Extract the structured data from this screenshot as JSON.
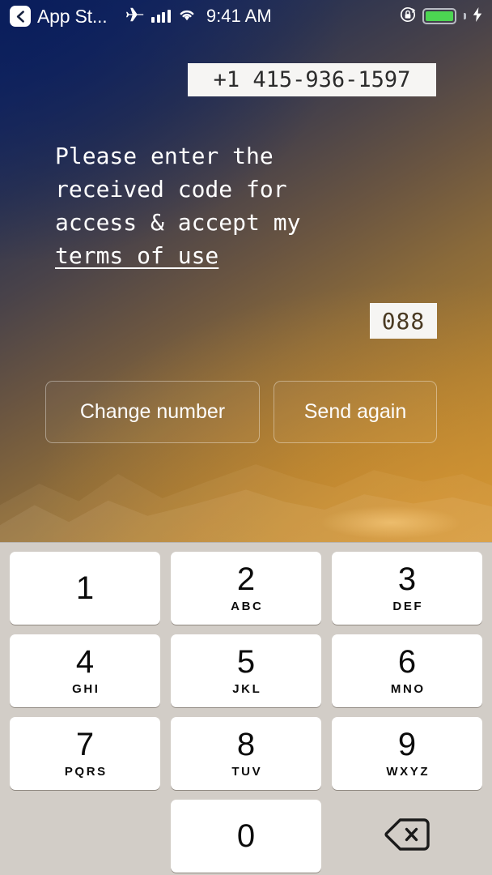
{
  "status_bar": {
    "back_icon": "chevron-left-icon",
    "back_app_label": "App St...",
    "airplane_icon": "airplane-icon",
    "signal_icon": "cellular-bars-icon",
    "wifi_icon": "wifi-icon",
    "time": "9:41 AM",
    "rotation_lock_icon": "rotation-lock-icon",
    "battery_icon": "battery-full-icon",
    "charging_icon": "lightning-bolt-icon",
    "battery_color": "#4cd552"
  },
  "phone_field": {
    "value": "+1 415-936-1597",
    "placeholder": "Phone number"
  },
  "instruction": {
    "line1": "Please enter the",
    "line2": "received code for",
    "line3": "access & accept my",
    "terms_link": "terms of use"
  },
  "code_field": {
    "value": "088",
    "placeholder": "Code"
  },
  "actions": {
    "change_number_label": "Change number",
    "send_again_label": "Send again"
  },
  "keypad": {
    "keys": [
      {
        "digit": "1",
        "letters": ""
      },
      {
        "digit": "2",
        "letters": "ABC"
      },
      {
        "digit": "3",
        "letters": "DEF"
      },
      {
        "digit": "4",
        "letters": "GHI"
      },
      {
        "digit": "5",
        "letters": "JKL"
      },
      {
        "digit": "6",
        "letters": "MNO"
      },
      {
        "digit": "7",
        "letters": "PQRS"
      },
      {
        "digit": "8",
        "letters": "TUV"
      },
      {
        "digit": "9",
        "letters": "WXYZ"
      },
      {
        "digit": "0",
        "letters": ""
      }
    ],
    "backspace_icon": "backspace-delete-icon"
  }
}
